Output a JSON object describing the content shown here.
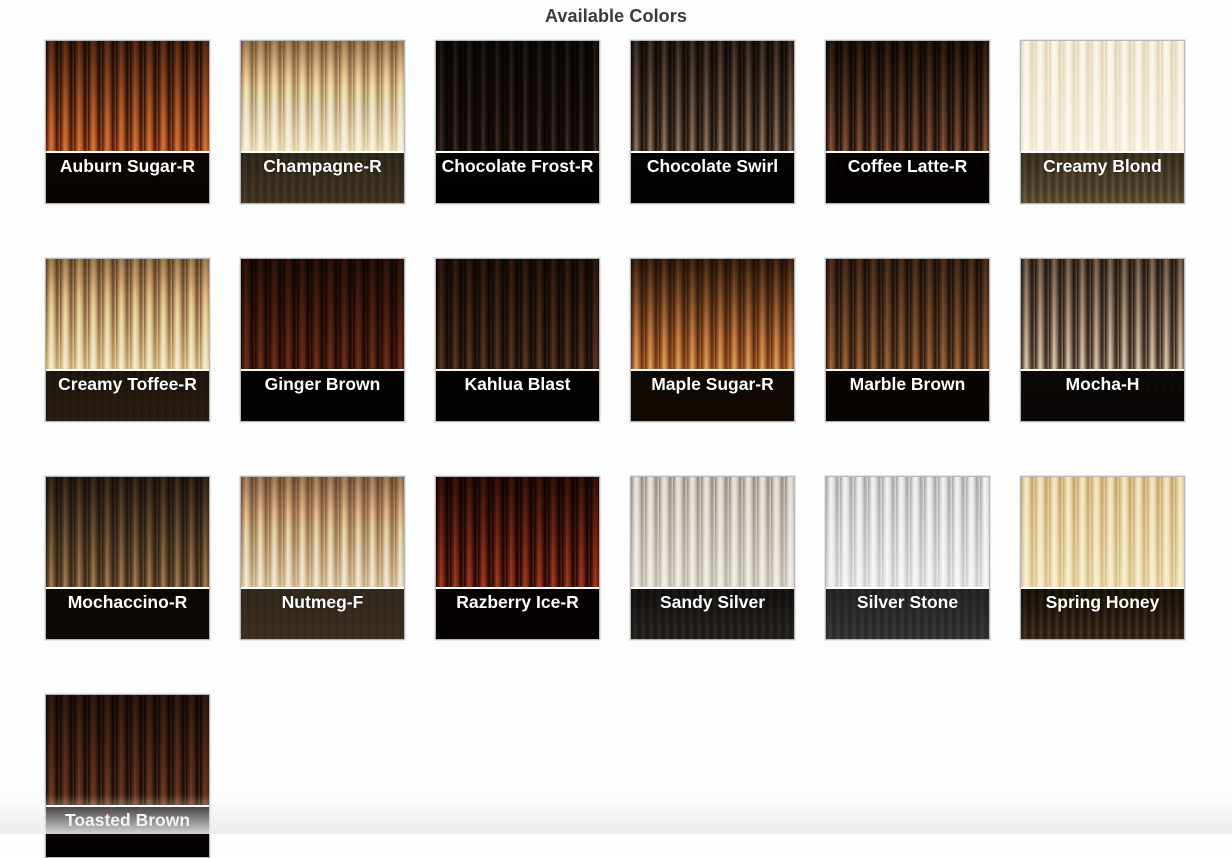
{
  "page": {
    "title": "Available Colors"
  },
  "swatches": [
    {
      "name": "Auburn Sugar-R",
      "icon": "auburn-sugar-r-swatch-icon",
      "top": "#3a271a",
      "mid": "#9b6a44",
      "light": "#c79a70",
      "dark": "#2a1a12",
      "band": "#3a2a1f"
    },
    {
      "name": "Champagne-R",
      "icon": "champagne-r-swatch-icon",
      "top": "#5a4838",
      "mid": "#d9cbb1",
      "light": "#f1e8d6",
      "dark": "#8f7d63",
      "band": "#5f5a4c"
    },
    {
      "name": "Chocolate Frost-R",
      "icon": "chocolate-frost-r-swatch-icon",
      "top": "#1f1814",
      "mid": "#3c302a",
      "light": "#8a8078",
      "dark": "#120d0b",
      "band": "#1e1612"
    },
    {
      "name": "Chocolate Swirl",
      "icon": "chocolate-swirl-swatch-icon",
      "top": "#2d2520",
      "mid": "#6b5d52",
      "light": "#b9afa4",
      "dark": "#1a1410",
      "band": "#2a221c"
    },
    {
      "name": "Coffee Latte-R",
      "icon": "coffee-latte-r-swatch-icon",
      "top": "#241a14",
      "mid": "#6d5442",
      "light": "#a58870",
      "dark": "#1a120d",
      "band": "#2c2019"
    },
    {
      "name": "Creamy Blond",
      "icon": "creamy-blond-swatch-icon",
      "top": "#cfc4ad",
      "mid": "#e3dac7",
      "light": "#f3ede0",
      "dark": "#a89a7e",
      "band": "#6a604e"
    },
    {
      "name": "Creamy Toffee-R",
      "icon": "creamy-toffee-r-swatch-icon",
      "top": "#5b4a38",
      "mid": "#c9b79a",
      "light": "#eee3cc",
      "dark": "#6d5a44",
      "band": "#514634"
    },
    {
      "name": "Ginger Brown",
      "icon": "ginger-brown-swatch-icon",
      "top": "#2b1b14",
      "mid": "#6a4330",
      "light": "#8c5e45",
      "dark": "#1b110d",
      "band": "#22160f"
    },
    {
      "name": "Kahlua Blast",
      "icon": "kahlua-blast-swatch-icon",
      "top": "#2a1f18",
      "mid": "#5a4435",
      "light": "#8b6e55",
      "dark": "#1a130f",
      "band": "#1f1712"
    },
    {
      "name": "Maple Sugar-R",
      "icon": "maple-sugar-r-swatch-icon",
      "top": "#2a1e16",
      "mid": "#a07a55",
      "light": "#d6b58e",
      "dark": "#4a3524",
      "band": "#3b2c20"
    },
    {
      "name": "Marble Brown",
      "icon": "marble-brown-swatch-icon",
      "top": "#3a2c20",
      "mid": "#7c6249",
      "light": "#a88a6b",
      "dark": "#2a1f16",
      "band": "#2e241b"
    },
    {
      "name": "Mocha-H",
      "icon": "mocha-h-swatch-icon",
      "top": "#4a3e35",
      "mid": "#8e8276",
      "light": "#dcd5cc",
      "dark": "#2a221d",
      "band": "#3a342e"
    },
    {
      "name": "Mochaccino-R",
      "icon": "mochaccino-r-swatch-icon",
      "top": "#2a211a",
      "mid": "#7b6a53",
      "light": "#b3a285",
      "dark": "#3a2f24",
      "band": "#3a3126"
    },
    {
      "name": "Nutmeg-F",
      "icon": "nutmeg-f-swatch-icon",
      "top": "#5d4a3b",
      "mid": "#c4b39c",
      "light": "#ede3d2",
      "dark": "#826e5a",
      "band": "#6a6356"
    },
    {
      "name": "Razberry Ice-R",
      "icon": "razberry-ice-r-swatch-icon",
      "top": "#2a1610",
      "mid": "#7d4330",
      "light": "#b07a5a",
      "dark": "#1c0f0b",
      "band": "#2c1912"
    },
    {
      "name": "Sandy Silver",
      "icon": "sandy-silver-swatch-icon",
      "top": "#9f9891",
      "mid": "#c4bfb8",
      "light": "#e6e2dc",
      "dark": "#6f6a64",
      "band": "#3c3936"
    },
    {
      "name": "Silver Stone",
      "icon": "silver-stone-swatch-icon",
      "top": "#a3a2a1",
      "mid": "#cfcfcf",
      "light": "#f0f0f0",
      "dark": "#7e7d7c",
      "band": "#575656"
    },
    {
      "name": "Spring Honey",
      "icon": "spring-honey-swatch-icon",
      "top": "#b9a483",
      "mid": "#d6c4a4",
      "light": "#ece0c8",
      "dark": "#8d7759",
      "band": "#3d342a"
    },
    {
      "name": "Toasted Brown",
      "icon": "toasted-brown-swatch-icon",
      "top": "#2e2018",
      "mid": "#6b4c38",
      "light": "#8f6a50",
      "dark": "#1e140f",
      "band": "#2a1c14"
    }
  ]
}
